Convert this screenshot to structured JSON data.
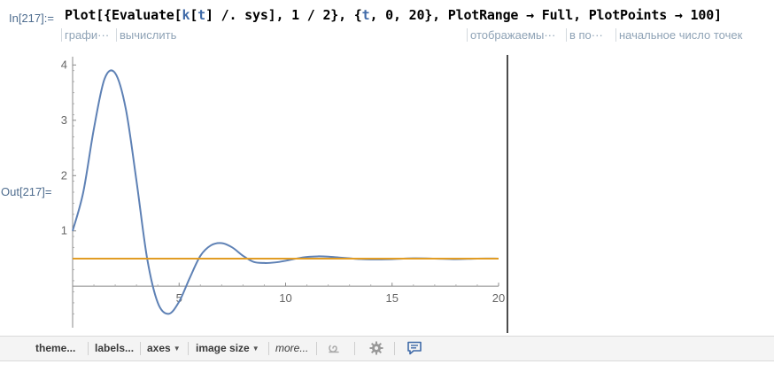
{
  "cell": {
    "in_label": "In[217]:=",
    "out_label": "Out[217]=",
    "code": [
      {
        "t": "Plot[{Evaluate[",
        "c": ""
      },
      {
        "t": "k",
        "c": "blue"
      },
      {
        "t": "[",
        "c": ""
      },
      {
        "t": "t",
        "c": "blue"
      },
      {
        "t": "] /. sys], 1 / 2}, {",
        "c": ""
      },
      {
        "t": "t",
        "c": "blue"
      },
      {
        "t": ", 0, 20}, PlotRange → Full, PlotPoints → 100]",
        "c": ""
      }
    ],
    "hints": [
      "графи···",
      "вычислить",
      "отображаемы···",
      "в по···",
      "начальное число точек"
    ]
  },
  "chart_data": {
    "type": "line",
    "xlim": [
      0,
      20
    ],
    "ylim": [
      -0.75,
      4.15
    ],
    "x_ticks": [
      5,
      10,
      15,
      20
    ],
    "y_ticks": [
      1,
      2,
      3,
      4
    ],
    "grid": false,
    "series": [
      {
        "color": "#5e81b5",
        "x": [
          0,
          0.5,
          1,
          1.5,
          2,
          2.5,
          3,
          3.5,
          4,
          4.5,
          5,
          5.5,
          6,
          6.5,
          7,
          7.5,
          8,
          8.5,
          9,
          9.5,
          10,
          10.5,
          11,
          11.5,
          12,
          12.5,
          13,
          13.5,
          14,
          15,
          16,
          17,
          18,
          19,
          20
        ],
        "y": [
          1.0,
          1.7,
          2.85,
          3.75,
          3.85,
          3.2,
          1.9,
          0.5,
          -0.3,
          -0.5,
          -0.28,
          0.15,
          0.55,
          0.74,
          0.78,
          0.7,
          0.55,
          0.44,
          0.42,
          0.43,
          0.46,
          0.5,
          0.53,
          0.54,
          0.535,
          0.52,
          0.505,
          0.49,
          0.485,
          0.49,
          0.505,
          0.5,
          0.49,
          0.5,
          0.5
        ]
      },
      {
        "color": "#e19c24",
        "x": [
          0,
          20
        ],
        "y": [
          0.5,
          0.5
        ]
      }
    ]
  },
  "toolbar": {
    "theme_label": "theme...",
    "labels_label": "labels...",
    "axes_label": "axes",
    "image_size_label": "image size",
    "more_label": "more...",
    "icons": [
      "spiral-icon",
      "gear-icon",
      "comment-icon"
    ]
  }
}
